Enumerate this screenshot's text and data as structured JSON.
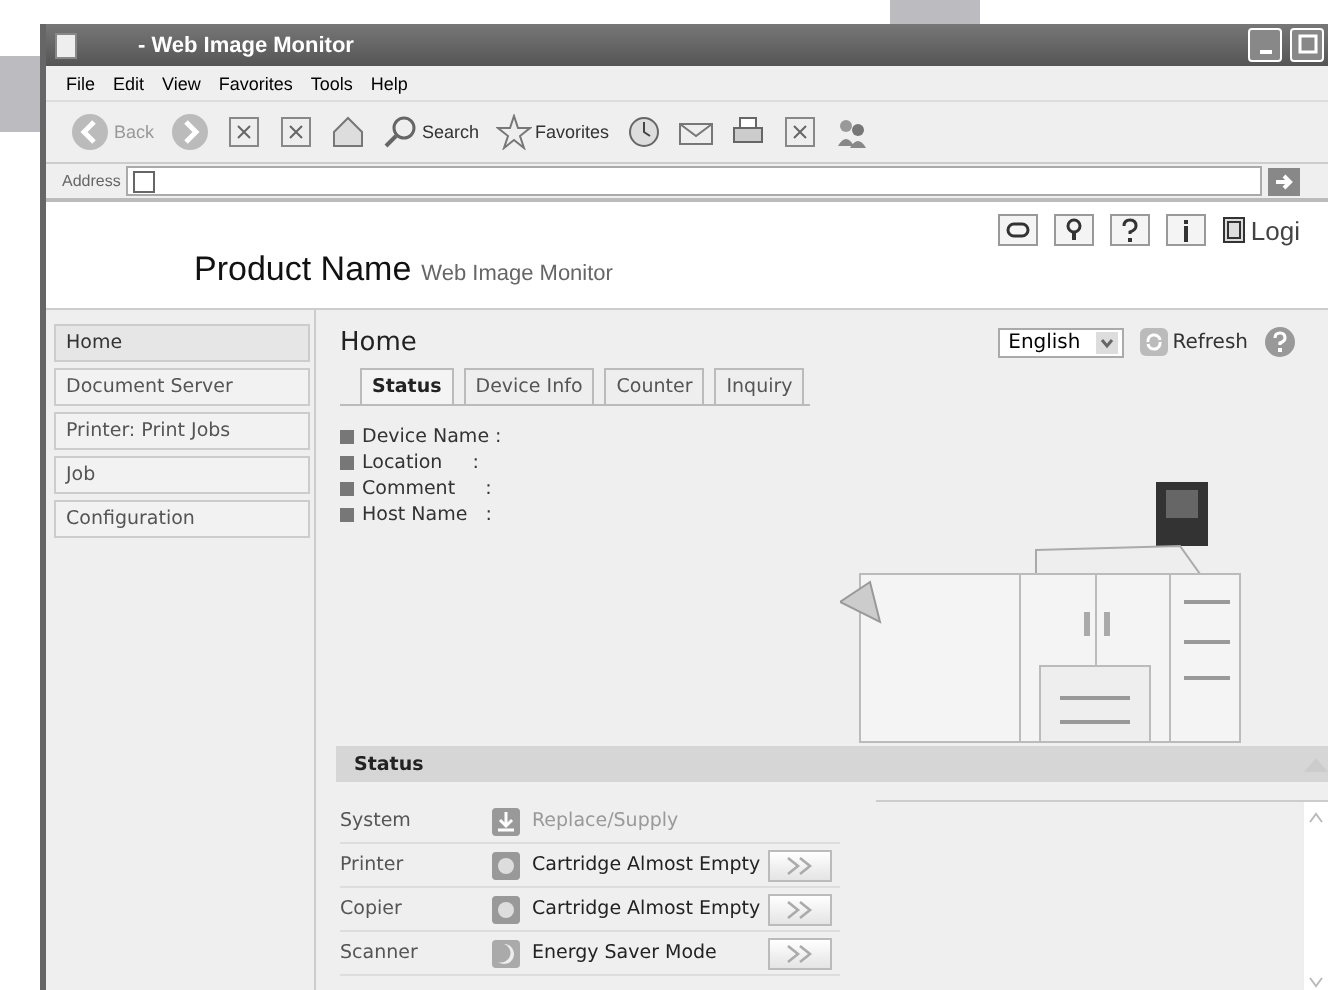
{
  "window": {
    "title": "- Web Image Monitor"
  },
  "menu": [
    "File",
    "Edit",
    "View",
    "Favorites",
    "Tools",
    "Help"
  ],
  "toolbar": [
    {
      "kind": "back",
      "label": "Back"
    },
    {
      "kind": "forward"
    },
    {
      "kind": "stop"
    },
    {
      "kind": "refresh"
    },
    {
      "kind": "home"
    },
    {
      "kind": "search",
      "label": "Search"
    },
    {
      "kind": "favorites",
      "label": "Favorites"
    },
    {
      "kind": "history"
    },
    {
      "kind": "mail"
    },
    {
      "kind": "print"
    },
    {
      "kind": "edit"
    },
    {
      "kind": "messenger"
    }
  ],
  "address": {
    "label": "Address"
  },
  "header": {
    "product": "Product Name",
    "subtitle": "Web Image Monitor",
    "login": "Logi"
  },
  "sidebar": {
    "items": [
      {
        "label": "Home",
        "selected": true
      },
      {
        "label": "Document Server",
        "selected": false
      },
      {
        "label": "Printer: Print Jobs",
        "selected": false
      },
      {
        "label": "Job",
        "selected": false
      },
      {
        "label": "Configuration",
        "selected": false
      }
    ]
  },
  "page": {
    "title": "Home",
    "language": "English",
    "refresh": "Refresh"
  },
  "tabs": [
    {
      "label": "Status",
      "selected": true
    },
    {
      "label": "Device Info",
      "selected": false
    },
    {
      "label": "Counter",
      "selected": false
    },
    {
      "label": "Inquiry",
      "selected": false
    }
  ],
  "device_info": [
    {
      "label": "Device Name :"
    },
    {
      "label": "Location     :"
    },
    {
      "label": "Comment     :"
    },
    {
      "label": "Host Name   :"
    }
  ],
  "status": {
    "title": "Status",
    "rows": [
      {
        "name": "System",
        "kind": "supply",
        "message": "Replace/Supply",
        "disabled": true,
        "details_button": false
      },
      {
        "name": "Printer",
        "kind": "cartridge",
        "message": "Cartridge Almost Empty",
        "disabled": false,
        "details_button": true
      },
      {
        "name": "Copier",
        "kind": "cartridge",
        "message": "Cartridge Almost Empty",
        "disabled": false,
        "details_button": true
      },
      {
        "name": "Scanner",
        "kind": "energy",
        "message": "Energy Saver Mode",
        "disabled": false,
        "details_button": true
      }
    ]
  }
}
